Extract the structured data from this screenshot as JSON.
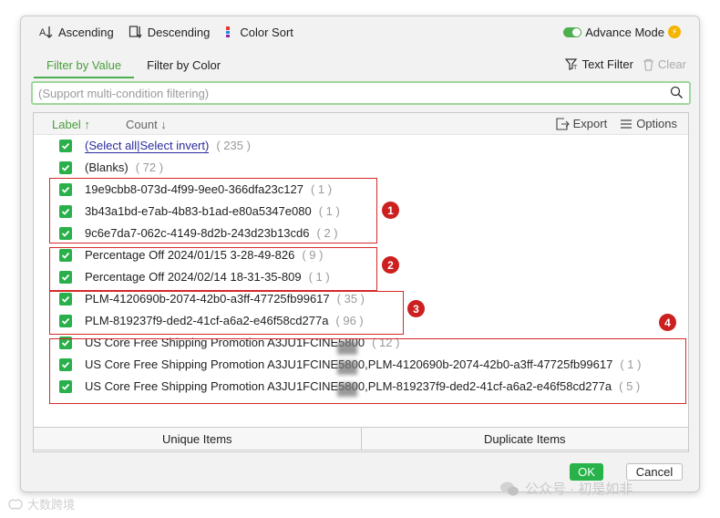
{
  "toolbar": {
    "ascending": "Ascending",
    "descending": "Descending",
    "color_sort": "Color Sort",
    "advance_mode": "Advance Mode"
  },
  "tabs": {
    "filter_by_value": "Filter by Value",
    "filter_by_color": "Filter by Color",
    "text_filter": "Text Filter",
    "clear": "Clear"
  },
  "search": {
    "placeholder": "(Support multi-condition filtering)",
    "value": ""
  },
  "list_header": {
    "label": "Label",
    "count": "Count",
    "export": "Export",
    "options": "Options"
  },
  "select_row": {
    "select_all": "(Select all",
    "select_invert": "Select invert)",
    "count": "( 235 )"
  },
  "items": [
    {
      "label": "(Blanks)",
      "count": "( 72 )"
    },
    {
      "label": "19e9cbb8-073d-4f99-9ee0-366dfa23c127",
      "count": "( 1 )"
    },
    {
      "label": "3b43a1bd-e7ab-4b83-b1ad-e80a5347e080",
      "count": "( 1 )"
    },
    {
      "label": "9c6e7da7-062c-4149-8d2b-243d23b13cd6",
      "count": "( 2 )"
    },
    {
      "label": "Percentage Off 2024/01/15 3-28-49-826",
      "count": "( 9 )"
    },
    {
      "label": "Percentage Off 2024/02/14 18-31-35-809",
      "count": "( 1 )"
    },
    {
      "label": "PLM-4120690b-2074-42b0-a3ff-47725fb99617",
      "count": "( 35 )"
    },
    {
      "label": "PLM-819237f9-ded2-41cf-a6a2-e46f58cd277a",
      "count": "( 96 )"
    },
    {
      "label": "US Core Free Shipping Promotion A3JU1FCINE5800",
      "count": "( 12 )"
    },
    {
      "label": "US Core Free Shipping Promotion A3JU1FCINE5800,PLM-4120690b-2074-42b0-a3ff-47725fb99617",
      "count": "( 1 )"
    },
    {
      "label": "US Core Free Shipping Promotion A3JU1FCINE5800,PLM-819237f9-ded2-41cf-a6a2-e46f58cd277a",
      "count": "( 5 )"
    }
  ],
  "annotations": [
    "1",
    "2",
    "3",
    "4"
  ],
  "bottom": {
    "unique_items": "Unique Items",
    "duplicate_items": "Duplicate Items"
  },
  "buttons": {
    "ok": "OK",
    "cancel": "Cancel"
  },
  "watermarks": {
    "left": "大数跨境",
    "right": "公众号 · 初是如非"
  },
  "colors": {
    "accent": "#4caf50",
    "checkbox": "#29b04a",
    "annotation": "#d42a2a"
  }
}
